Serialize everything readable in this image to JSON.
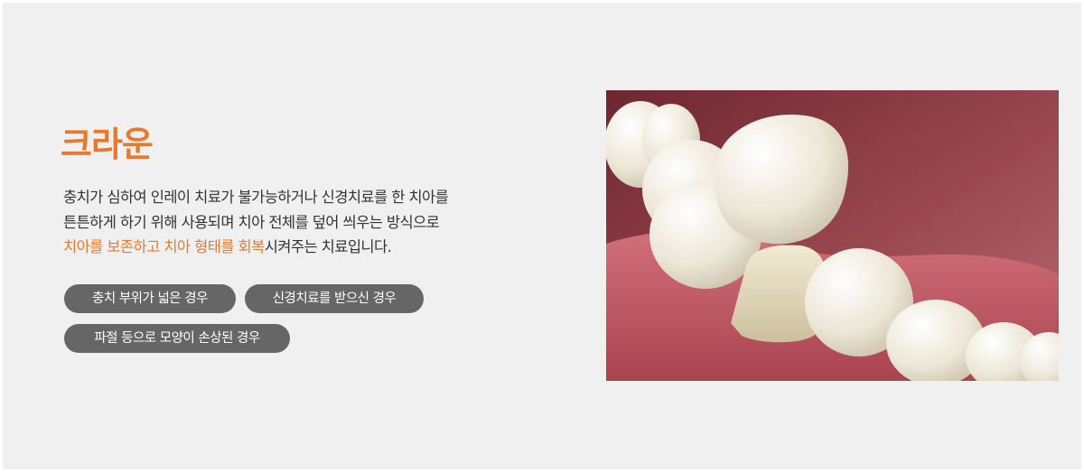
{
  "section": {
    "title": "크라운",
    "description": {
      "line1": "충치가 심하여 인레이 치료가 불가능하거나 신경치료를 한 치아를",
      "line2": "튼튼하게 하기 위해 사용되며 치아 전체를 덮어 씌우는 방식으로",
      "line3_highlight": "치아를 보존하고 치아 형태를 회복",
      "line3_rest": "시켜주는 치료입니다."
    },
    "tags": [
      "충치 부위가 넓은 경우",
      "신경치료를 받으신 경우",
      "파절 등으로 모양이 손상된 경우"
    ]
  },
  "image": {
    "subject": "dental crown illustration",
    "colors": {
      "gum": "#b85560",
      "tooth": "#ece7da",
      "accent": "#e8782a"
    }
  }
}
